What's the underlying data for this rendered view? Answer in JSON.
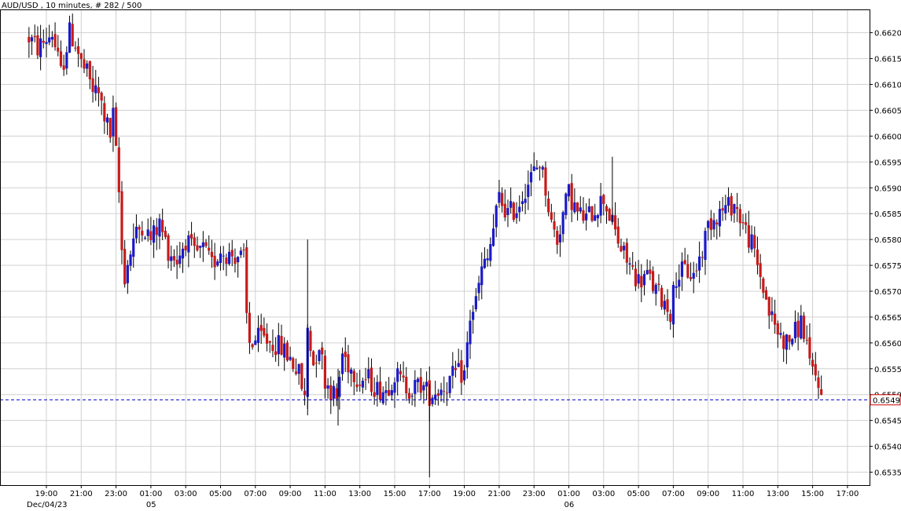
{
  "header": {
    "title": "AUD/USD , 10 minutes, # 282 / 500"
  },
  "chart_data": {
    "type": "candlestick",
    "symbol": "AUD/USD",
    "interval": "10 minutes",
    "ylim": [
      0.65325,
      0.66245
    ],
    "yticks": [
      "0.6620",
      "0.6615",
      "0.6610",
      "0.6605",
      "0.6600",
      "0.6595",
      "0.6590",
      "0.6585",
      "0.6580",
      "0.6575",
      "0.6570",
      "0.6565",
      "0.6560",
      "0.6555",
      "0.6550",
      "0.6545",
      "0.6540",
      "0.6535"
    ],
    "xticks": [
      "19:00",
      "21:00",
      "23:00",
      "01:00",
      "03:00",
      "05:00",
      "07:00",
      "09:00",
      "11:00",
      "13:00",
      "15:00",
      "17:00",
      "19:00",
      "21:00",
      "23:00",
      "01:00",
      "03:00",
      "05:00",
      "07:00",
      "09:00",
      "11:00",
      "13:00",
      "15:00",
      "17:00"
    ],
    "date_labels": [
      "Dec/04/23",
      "05",
      "06"
    ],
    "current_price": "0.6549",
    "colors": {
      "up": "#1a1ac8",
      "down": "#c81a1a",
      "wick": "#000000",
      "grid": "#d0d0d0",
      "price_line": "#0000cc"
    },
    "path": [
      {
        "t": "18:00",
        "price": 0.6619
      },
      {
        "t": "18:30",
        "price": 0.6617
      },
      {
        "t": "19:20",
        "price": 0.662
      },
      {
        "t": "19:50",
        "price": 0.6612
      },
      {
        "t": "20:20",
        "price": 0.662
      },
      {
        "t": "20:40",
        "price": 0.6618
      },
      {
        "t": "21:00",
        "price": 0.6614
      },
      {
        "t": "21:20",
        "price": 0.6612
      },
      {
        "t": "21:40",
        "price": 0.6609
      },
      {
        "t": "22:00",
        "price": 0.6608
      },
      {
        "t": "22:20",
        "price": 0.6604
      },
      {
        "t": "22:40",
        "price": 0.66
      },
      {
        "t": "22:50",
        "price": 0.6604
      },
      {
        "t": "23:10",
        "price": 0.6589
      },
      {
        "t": "23:20",
        "price": 0.6578
      },
      {
        "t": "23:30",
        "price": 0.6573
      },
      {
        "t": "00:00",
        "price": 0.658
      },
      {
        "t": "00:30",
        "price": 0.6583
      },
      {
        "t": "01:00",
        "price": 0.658
      },
      {
        "t": "01:30",
        "price": 0.6583
      },
      {
        "t": "02:00",
        "price": 0.6578
      },
      {
        "t": "02:30",
        "price": 0.6576
      },
      {
        "t": "03:00",
        "price": 0.658
      },
      {
        "t": "03:30",
        "price": 0.6577
      },
      {
        "t": "04:00",
        "price": 0.6578
      },
      {
        "t": "04:30",
        "price": 0.6575
      },
      {
        "t": "05:00",
        "price": 0.6578
      },
      {
        "t": "05:30",
        "price": 0.6577
      },
      {
        "t": "06:00",
        "price": 0.6577
      },
      {
        "t": "06:20",
        "price": 0.6576
      },
      {
        "t": "06:30",
        "price": 0.6565
      },
      {
        "t": "06:40",
        "price": 0.656
      },
      {
        "t": "07:20",
        "price": 0.6561
      },
      {
        "t": "08:00",
        "price": 0.656
      },
      {
        "t": "08:30",
        "price": 0.6559
      },
      {
        "t": "09:00",
        "price": 0.6557
      },
      {
        "t": "09:30",
        "price": 0.6554
      },
      {
        "t": "09:50",
        "price": 0.6549
      },
      {
        "t": "10:00",
        "price": 0.6563
      },
      {
        "t": "10:20",
        "price": 0.6556
      },
      {
        "t": "10:40",
        "price": 0.656
      },
      {
        "t": "11:00",
        "price": 0.6553
      },
      {
        "t": "11:20",
        "price": 0.6551
      },
      {
        "t": "11:40",
        "price": 0.6549
      },
      {
        "t": "12:00",
        "price": 0.6558
      },
      {
        "t": "12:30",
        "price": 0.6555
      },
      {
        "t": "13:00",
        "price": 0.6553
      },
      {
        "t": "13:30",
        "price": 0.6553
      },
      {
        "t": "14:00",
        "price": 0.6551
      },
      {
        "t": "14:30",
        "price": 0.6551
      },
      {
        "t": "15:00",
        "price": 0.6554
      },
      {
        "t": "15:30",
        "price": 0.6552
      },
      {
        "t": "16:00",
        "price": 0.6551
      },
      {
        "t": "16:30",
        "price": 0.6552
      },
      {
        "t": "17:00",
        "price": 0.655
      },
      {
        "t": "17:30",
        "price": 0.6551
      },
      {
        "t": "18:00",
        "price": 0.6552
      },
      {
        "t": "18:30",
        "price": 0.6554
      },
      {
        "t": "19:00",
        "price": 0.6554
      },
      {
        "t": "19:20",
        "price": 0.6565
      },
      {
        "t": "19:40",
        "price": 0.6568
      },
      {
        "t": "20:00",
        "price": 0.6574
      },
      {
        "t": "20:20",
        "price": 0.6576
      },
      {
        "t": "20:40",
        "price": 0.6582
      },
      {
        "t": "21:00",
        "price": 0.6588
      },
      {
        "t": "21:30",
        "price": 0.6585
      },
      {
        "t": "22:00",
        "price": 0.6586
      },
      {
        "t": "22:30",
        "price": 0.659
      },
      {
        "t": "23:00",
        "price": 0.6593
      },
      {
        "t": "23:20",
        "price": 0.6595
      },
      {
        "t": "23:40",
        "price": 0.659
      },
      {
        "t": "00:00",
        "price": 0.6583
      },
      {
        "t": "00:20",
        "price": 0.658
      },
      {
        "t": "00:40",
        "price": 0.6585
      },
      {
        "t": "01:00",
        "price": 0.6589
      },
      {
        "t": "01:30",
        "price": 0.6585
      },
      {
        "t": "02:00",
        "price": 0.6584
      },
      {
        "t": "02:30",
        "price": 0.6586
      },
      {
        "t": "03:00",
        "price": 0.6588
      },
      {
        "t": "03:30",
        "price": 0.6583
      },
      {
        "t": "04:00",
        "price": 0.6578
      },
      {
        "t": "04:30",
        "price": 0.6575
      },
      {
        "t": "05:00",
        "price": 0.6572
      },
      {
        "t": "05:30",
        "price": 0.6573
      },
      {
        "t": "06:00",
        "price": 0.657
      },
      {
        "t": "06:30",
        "price": 0.6568
      },
      {
        "t": "06:50",
        "price": 0.6566
      },
      {
        "t": "07:10",
        "price": 0.6573
      },
      {
        "t": "07:40",
        "price": 0.6574
      },
      {
        "t": "08:10",
        "price": 0.6573
      },
      {
        "t": "08:40",
        "price": 0.6578
      },
      {
        "t": "09:00",
        "price": 0.6583
      },
      {
        "t": "09:30",
        "price": 0.6585
      },
      {
        "t": "10:00",
        "price": 0.6586
      },
      {
        "t": "10:30",
        "price": 0.6587
      },
      {
        "t": "11:00",
        "price": 0.6583
      },
      {
        "t": "11:30",
        "price": 0.6579
      },
      {
        "t": "12:00",
        "price": 0.6573
      },
      {
        "t": "12:30",
        "price": 0.6566
      },
      {
        "t": "13:00",
        "price": 0.6562
      },
      {
        "t": "13:30",
        "price": 0.656
      },
      {
        "t": "14:00",
        "price": 0.6562
      },
      {
        "t": "14:20",
        "price": 0.6564
      },
      {
        "t": "14:40",
        "price": 0.656
      },
      {
        "t": "14:50",
        "price": 0.6555
      },
      {
        "t": "15:20",
        "price": 0.6553
      },
      {
        "t": "15:30",
        "price": 0.6549
      }
    ]
  }
}
